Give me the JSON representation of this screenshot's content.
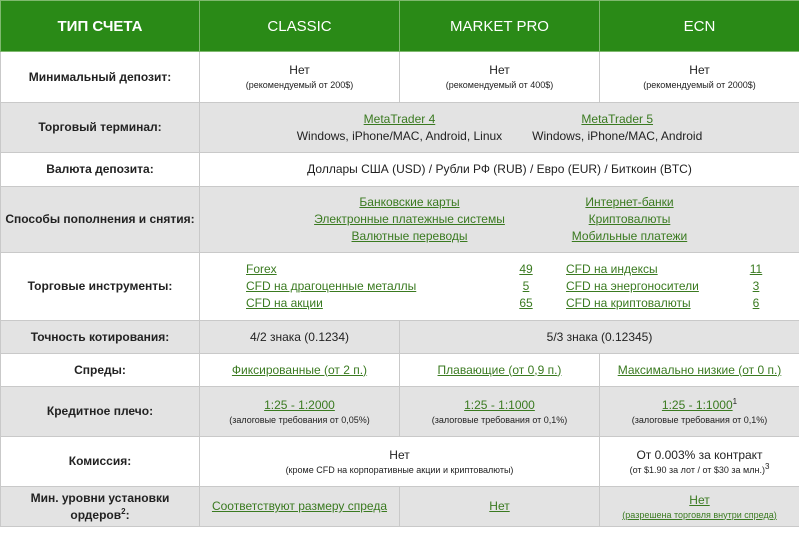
{
  "header": {
    "account_type": "ТИП СЧЕТА",
    "col1": "CLASSIC",
    "col2": "MARKET PRO",
    "col3": "ECN"
  },
  "min_deposit": {
    "label": "Минимальный депозит:",
    "classic": {
      "value": "Нет",
      "note": "(рекомендуемый от 200$)"
    },
    "market_pro": {
      "value": "Нет",
      "note": "(рекомендуемый от 400$)"
    },
    "ecn": {
      "value": "Нет",
      "note": "(рекомендуемый от 2000$)"
    }
  },
  "terminal": {
    "label": "Торговый терминал:",
    "t1": {
      "name": "MetaTrader 4",
      "platforms": "Windows, iPhone/MAC, Android, Linux"
    },
    "t2": {
      "name": "MetaTrader 5",
      "platforms": "Windows, iPhone/MAC, Android"
    }
  },
  "currency": {
    "label": "Валюта депозита:",
    "value": "Доллары США (USD) / Рубли РФ (RUB) / Евро (EUR) / Биткоин (BTC)"
  },
  "deposit_methods": {
    "label": "Способы пополнения и снятия:",
    "items": [
      "Банковские карты",
      "Интернет-банки",
      "Электронные платежные системы",
      "Криптовалюты",
      "Валютные переводы",
      "Мобильные платежи"
    ]
  },
  "instruments": {
    "label": "Торговые инструменты:",
    "left": [
      {
        "name": "Forex",
        "count": "49"
      },
      {
        "name": "CFD на драгоценные металлы",
        "count": "5"
      },
      {
        "name": "CFD на акции",
        "count": "65"
      }
    ],
    "right": [
      {
        "name": "CFD на индексы",
        "count": "11"
      },
      {
        "name": "CFD на энергоносители",
        "count": "3"
      },
      {
        "name": "CFD на криптовалюты",
        "count": "6"
      }
    ]
  },
  "precision": {
    "label": "Точность котирования:",
    "classic": "4/2 знака (0.1234)",
    "others": "5/3 знака (0.12345)"
  },
  "spreads": {
    "label": "Спреды:",
    "classic": "Фиксированные (от 2 п.)",
    "market_pro": "Плавающие (от 0,9 п.)",
    "ecn": "Максимально низкие (от 0 п.)"
  },
  "leverage": {
    "label": "Кредитное плечо:",
    "classic": {
      "value": "1:25 - 1:2000",
      "note": "(залоговые требования от 0,05%)"
    },
    "market_pro": {
      "value": "1:25 - 1:1000",
      "note": "(залоговые требования от 0,1%)"
    },
    "ecn": {
      "value": "1:25 - 1:1000",
      "sup": "1",
      "note": "(залоговые требования от 0,1%)"
    }
  },
  "commission": {
    "label": "Комиссия:",
    "classic_pro": {
      "value": "Нет",
      "note": "(кроме CFD на корпоративные акции и криптовалюты)"
    },
    "ecn": {
      "value": "От 0.003% за контракт",
      "note": "(от $1.90 за лот / от $30 за млн.)",
      "sup": "3"
    }
  },
  "min_levels": {
    "label_line1": "Мин. уровни установки",
    "label_line2": "ордеров",
    "label_sup": "2",
    "label_tail": ":",
    "classic": "Соответствуют размеру спреда",
    "market_pro": "Нет",
    "ecn": {
      "value": "Нет",
      "note": "(разрешена торговля внутри спреда)"
    }
  }
}
